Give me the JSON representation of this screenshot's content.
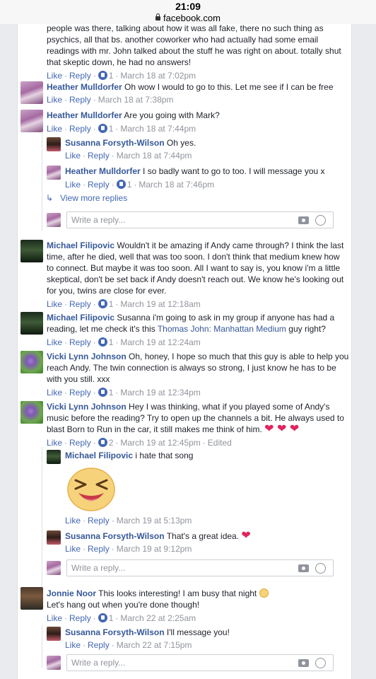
{
  "status": {
    "time": "21:09",
    "url": "facebook.com"
  },
  "colors": {
    "link": "#365899",
    "action": "#4267b2",
    "meta": "#90949c",
    "heart": "#e0245e"
  },
  "top_comment": {
    "text_lines": [
      "people was there, talking about how it was all fake, there no such thing as",
      "psychics, all that bs. another coworker who had actually had some email",
      "readings with mr. John talked about the stuff he was right on about. totally shut",
      "that skeptic down, he had no answers!"
    ],
    "like": "Like",
    "reply": "Reply",
    "likes": "1",
    "time": "March 18 at 7:02pm"
  },
  "c_heather1": {
    "name": "Heather Mulldorfer",
    "text": "Oh wow I would to go to this. Let me see if I can be free",
    "like": "Like",
    "reply": "Reply",
    "time": "March 18 at 7:38pm"
  },
  "c_heather2": {
    "name": "Heather Mulldorfer",
    "text": "Are you going with Mark?",
    "like": "Like",
    "reply": "Reply",
    "likes": "1",
    "time": "March 18 at 7:44pm"
  },
  "r_susanna1": {
    "name": "Susanna Forsyth-Wilson",
    "text": "Oh yes.",
    "like": "Like",
    "reply": "Reply",
    "time": "March 18 at 7:44pm"
  },
  "r_heather3": {
    "name": "Heather Mulldorfer",
    "text": "I so badly want to go to too. I will message you x",
    "like": "Like",
    "reply": "Reply",
    "likes": "1",
    "time": "March 18 at 7:46pm"
  },
  "view_more": "View more replies",
  "reply_placeholder": "Write a reply...",
  "c_michael1": {
    "name": "Michael Filipovic",
    "text_lines": [
      "Wouldn't it be amazing if Andy came through? I think the last",
      "time, after he died, well that was too soon. I don't think that medium knew how",
      "to connect. But maybe it was too soon. All I want to say is, you know i'm a little",
      "skeptical, don't be set back if Andy doesn't reach out. We know he's looking out",
      "for you, twins are close for ever."
    ],
    "like": "Like",
    "reply": "Reply",
    "likes": "1",
    "time": "March 19 at 12:18am"
  },
  "c_michael2": {
    "name": "Michael Filipovic",
    "text_a": "Susanna i'm going to ask in my group if anyone has had a",
    "text_b": "reading, let me check it's this",
    "link": "Thomas John: Manhattan Medium",
    "text_c": "guy right?",
    "like": "Like",
    "reply": "Reply",
    "likes": "1",
    "time": "March 19 at 12:24am"
  },
  "c_vicki1": {
    "name": "Vicki Lynn Johnson",
    "text_lines": [
      "Oh, honey, I hope so much that this guy is able to help you",
      "reach Andy. The twin connection is always so strong, I just know he has to be",
      "with you still. xxx"
    ],
    "like": "Like",
    "reply": "Reply",
    "likes": "1",
    "time": "March 19 at 12:34pm"
  },
  "c_vicki2": {
    "name": "Vicki Lynn Johnson",
    "text_lines": [
      "Hey I was thinking, what if you played some of Andy's",
      "music before the reading? Try to open up the channels a bit. He always used to",
      "blast Born to Run in the car, it still makes me think of him."
    ],
    "hearts": "❤ ❤ ❤",
    "like": "Like",
    "reply": "Reply",
    "likes": "2",
    "time": "March 19 at 12:45pm",
    "edited": "Edited"
  },
  "r_michael3": {
    "name": "Michael Filipovic",
    "text": "i hate that song",
    "like": "Like",
    "reply": "Reply",
    "time": "March 19 at 5:13pm"
  },
  "r_susanna2": {
    "name": "Susanna Forsyth-Wilson",
    "text": "That's a great idea.",
    "heart": "❤",
    "like": "Like",
    "reply": "Reply",
    "time": "March 19 at 9:12pm"
  },
  "c_jonnie": {
    "name": "Jonnie Noor",
    "text_a": "This looks interesting! I am busy that night",
    "text_b": "Let's hang out when you're done though!",
    "like": "Like",
    "reply": "Reply",
    "likes": "1",
    "time": "March 22 at 2:25am"
  },
  "r_susanna3": {
    "name": "Susanna Forsyth-Wilson",
    "text": "I'll message you!",
    "like": "Like",
    "reply": "Reply",
    "time": "March 22 at 7:15pm"
  }
}
